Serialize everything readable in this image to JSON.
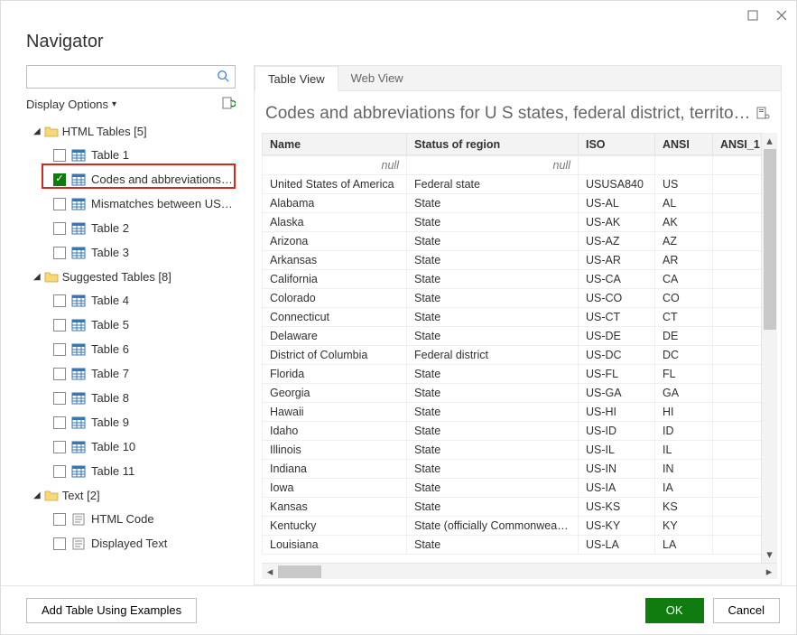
{
  "window": {
    "title": "Navigator"
  },
  "left": {
    "search_placeholder": "",
    "display_options": "Display Options",
    "folders": [
      {
        "label": "HTML Tables [5]",
        "items": [
          {
            "label": "Table 1",
            "checked": false
          },
          {
            "label": "Codes and abbreviations f...",
            "checked": true
          },
          {
            "label": "Mismatches between USP...",
            "checked": false
          },
          {
            "label": "Table 2",
            "checked": false
          },
          {
            "label": "Table 3",
            "checked": false
          }
        ]
      },
      {
        "label": "Suggested Tables [8]",
        "items": [
          {
            "label": "Table 4",
            "checked": false
          },
          {
            "label": "Table 5",
            "checked": false
          },
          {
            "label": "Table 6",
            "checked": false
          },
          {
            "label": "Table 7",
            "checked": false
          },
          {
            "label": "Table 8",
            "checked": false
          },
          {
            "label": "Table 9",
            "checked": false
          },
          {
            "label": "Table 10",
            "checked": false
          },
          {
            "label": "Table 11",
            "checked": false
          }
        ]
      },
      {
        "label": "Text [2]",
        "type": "text",
        "items": [
          {
            "label": "HTML Code",
            "checked": false,
            "icon": "text"
          },
          {
            "label": "Displayed Text",
            "checked": false,
            "icon": "text"
          }
        ]
      }
    ]
  },
  "right": {
    "tabs": {
      "view": "Table View",
      "web": "Web View"
    },
    "title": "Codes and abbreviations for U S states, federal district, territories,...",
    "columns": [
      "Name",
      "Status of region",
      "ISO",
      "ANSI",
      "ANSI_1"
    ],
    "null_text": "null",
    "rows": [
      [
        "United States of America",
        "Federal state",
        "USUSA840",
        "US",
        ""
      ],
      [
        "Alabama",
        "State",
        "US-AL",
        "AL",
        ""
      ],
      [
        "Alaska",
        "State",
        "US-AK",
        "AK",
        ""
      ],
      [
        "Arizona",
        "State",
        "US-AZ",
        "AZ",
        ""
      ],
      [
        "Arkansas",
        "State",
        "US-AR",
        "AR",
        ""
      ],
      [
        "California",
        "State",
        "US-CA",
        "CA",
        ""
      ],
      [
        "Colorado",
        "State",
        "US-CO",
        "CO",
        ""
      ],
      [
        "Connecticut",
        "State",
        "US-CT",
        "CT",
        ""
      ],
      [
        "Delaware",
        "State",
        "US-DE",
        "DE",
        ""
      ],
      [
        "District of Columbia",
        "Federal district",
        "US-DC",
        "DC",
        ""
      ],
      [
        "Florida",
        "State",
        "US-FL",
        "FL",
        ""
      ],
      [
        "Georgia",
        "State",
        "US-GA",
        "GA",
        ""
      ],
      [
        "Hawaii",
        "State",
        "US-HI",
        "HI",
        ""
      ],
      [
        "Idaho",
        "State",
        "US-ID",
        "ID",
        ""
      ],
      [
        "Illinois",
        "State",
        "US-IL",
        "IL",
        ""
      ],
      [
        "Indiana",
        "State",
        "US-IN",
        "IN",
        ""
      ],
      [
        "Iowa",
        "State",
        "US-IA",
        "IA",
        ""
      ],
      [
        "Kansas",
        "State",
        "US-KS",
        "KS",
        ""
      ],
      [
        "Kentucky",
        "State (officially Commonwealth)",
        "US-KY",
        "KY",
        ""
      ],
      [
        "Louisiana",
        "State",
        "US-LA",
        "LA",
        ""
      ]
    ]
  },
  "footer": {
    "add": "Add Table Using Examples",
    "ok": "OK",
    "cancel": "Cancel"
  }
}
